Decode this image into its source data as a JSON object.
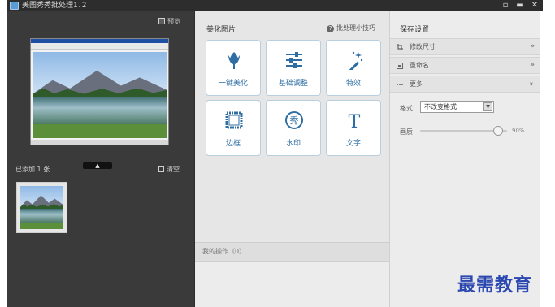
{
  "titlebar": {
    "title": "美图秀秀批处理1.2",
    "min_btn": "▫",
    "max_btn": "▬",
    "close_btn": "✕"
  },
  "left": {
    "preview_label": "预览",
    "added_count": "已添加 1 张",
    "clear_label": "清空",
    "collapse_glyph": "▲"
  },
  "center": {
    "section_title": "美化图片",
    "tips_label": "批处理小技巧",
    "tiles": [
      {
        "label": "一键美化",
        "icon": "tulip-icon"
      },
      {
        "label": "基础调整",
        "icon": "sliders-icon"
      },
      {
        "label": "特效",
        "icon": "magic-wand-icon"
      },
      {
        "label": "边框",
        "icon": "frame-icon"
      },
      {
        "label": "水印",
        "icon": "watermark-seal-icon"
      },
      {
        "label": "文字",
        "icon": "text-t-icon"
      }
    ],
    "watermark_glyph": "秀",
    "text_glyph": "T",
    "my_ops": "我的操作（0）"
  },
  "right": {
    "section_title": "保存设置",
    "sections": [
      {
        "label": "修改尺寸",
        "icon": "crop-icon",
        "chevron": "»"
      },
      {
        "label": "重命名",
        "icon": "rename-icon",
        "chevron": "»"
      },
      {
        "label": "更多",
        "icon": "more-dots-icon",
        "chevron": "«"
      }
    ],
    "format_label": "格式",
    "format_value": "不改变格式",
    "quality_label": "画质",
    "quality_value": "90%",
    "quality_level": 0.9
  },
  "watermark": "最需教育",
  "colors": {
    "accent": "#2f6ea3",
    "dark_bg": "#3a3a3a",
    "tile_border": "#b8cfe0"
  }
}
